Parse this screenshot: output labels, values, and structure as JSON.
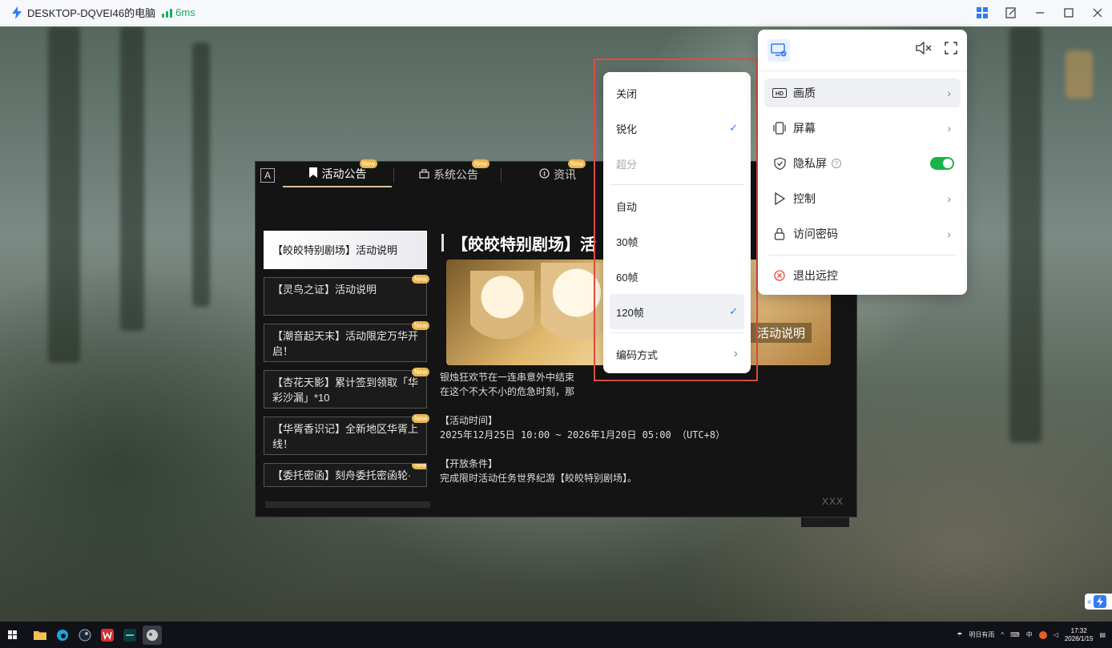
{
  "window": {
    "title": "DESKTOP-DQVEI46的电脑",
    "ping": "6ms"
  },
  "game": {
    "tab_a": "A",
    "tabs": [
      {
        "label": "活动公告",
        "badge": "New"
      },
      {
        "label": "系统公告",
        "badge": "New"
      },
      {
        "label": "资讯",
        "badge": "New"
      }
    ],
    "list": [
      {
        "label": "【皎皎特别剧场】活动说明",
        "badge": ""
      },
      {
        "label": "【灵鸟之证】活动说明",
        "badge": "New"
      },
      {
        "label": "【潮音起天末】活动限定万华开启！",
        "badge": "New"
      },
      {
        "label": "【杏花天影】累计签到领取「华彩沙漏」*10",
        "badge": "New"
      },
      {
        "label": "【华胥香识记】全新地区华胥上线！",
        "badge": "New"
      },
      {
        "label": "【委托密函】刻舟委托密函轮·",
        "badge": "New"
      }
    ],
    "article_title": "【皎皎特别剧场】活",
    "banner_label": "活动说明",
    "body": [
      "银烛狂欢节在一连串意外中结束",
      "在这个不大不小的危急时刻，那",
      "",
      "【活动时间】",
      "2025年12月25日 10:00 ~ 2026年1月20日 05:00 （UTC+8）",
      "",
      "【开放条件】",
      "完成限时活动任务世界纪游【皎皎特别剧场】。"
    ],
    "corner_mark": "XXX"
  },
  "quality_menu": {
    "items": [
      {
        "label": "关闭",
        "checked": false,
        "disabled": false
      },
      {
        "label": "锐化",
        "checked": true,
        "disabled": false
      },
      {
        "label": "超分",
        "checked": false,
        "disabled": true
      }
    ],
    "fps_items": [
      {
        "label": "自动",
        "checked": false
      },
      {
        "label": "30帧",
        "checked": false
      },
      {
        "label": "60帧",
        "checked": false
      },
      {
        "label": "120帧",
        "checked": true
      }
    ],
    "encoding_label": "编码方式",
    "check_mark": "✓",
    "chevron": "›"
  },
  "panel": {
    "items": [
      {
        "label": "画质",
        "icon": "hd-icon",
        "has_chevron": true
      },
      {
        "label": "屏幕",
        "icon": "screen-icon",
        "has_chevron": true
      },
      {
        "label": "隐私屏",
        "icon": "shield-icon",
        "has_toggle": true,
        "toggle_on": true
      },
      {
        "label": "控制",
        "icon": "play-icon",
        "has_chevron": true
      },
      {
        "label": "访问密码",
        "icon": "lock-icon",
        "has_chevron": true
      }
    ],
    "exit_label": "退出远控",
    "help_glyph": "?"
  },
  "taskbar": {
    "weather": "明日有雨",
    "ime": "中",
    "time": "17:32",
    "date": "2026/1/15"
  },
  "colors": {
    "accent": "#2f7cf6",
    "toggle_on": "#19b34a",
    "highlight_border": "#e24c3e",
    "signal": "#1aad5c"
  }
}
